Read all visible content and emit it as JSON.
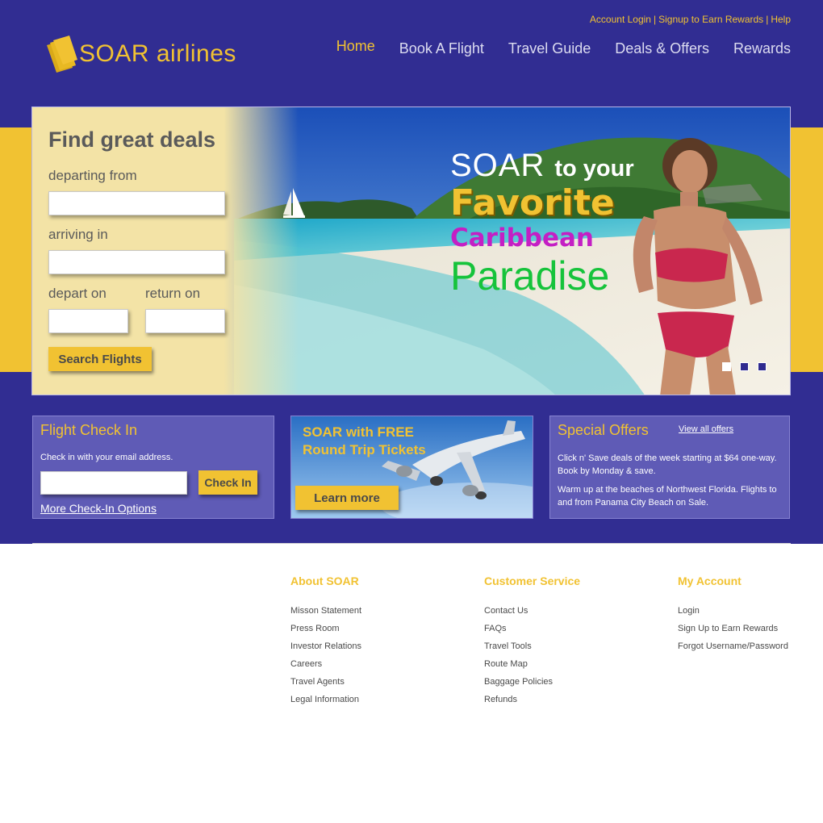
{
  "header": {
    "top_links": [
      "Account Login",
      "Signup to Earn Rewards",
      "Help"
    ],
    "logo": {
      "text": "SOAR airlines",
      "icon": "ticket-stack-icon"
    },
    "nav": [
      {
        "label": "Home",
        "active": true
      },
      {
        "label": "Book A Flight",
        "active": false
      },
      {
        "label": "Travel Guide",
        "active": false
      },
      {
        "label": "Deals & Offers",
        "active": false
      },
      {
        "label": "Rewards",
        "active": false
      }
    ]
  },
  "search": {
    "title": "Find great deals",
    "departing_label": "departing from",
    "departing_value": "",
    "arriving_label": "arriving in",
    "arriving_value": "",
    "depart_label": "depart on",
    "depart_value": "",
    "return_label": "return on",
    "return_value": "",
    "button": "Search Flights"
  },
  "hero_promo": {
    "soar": "SOAR",
    "to_your": "to your",
    "favorite": "Favorite",
    "caribbean": "Caribbean",
    "paradise": "Paradise",
    "slides": 3,
    "active_slide": 1
  },
  "checkin": {
    "title": "Flight Check In",
    "text": "Check in with your email address.",
    "input_value": "",
    "button": "Check In",
    "more": "More Check-In Options"
  },
  "free_tickets": {
    "line1": "SOAR with FREE",
    "line2": "Round Trip Tickets",
    "button": "Learn more"
  },
  "offers": {
    "title": "Special Offers",
    "link": "View all offers",
    "p1": "Click n' Save deals of the week starting at $64 one-way. Book by Monday & save.",
    "p2": "Warm up at the beaches of Northwest Florida. Flights to and from Panama City Beach on Sale."
  },
  "footer": {
    "about": {
      "title": "About SOAR",
      "links": [
        "Misson Statement",
        "Press Room",
        "Investor Relations",
        "Careers",
        "Travel Agents",
        "Legal Information"
      ]
    },
    "service": {
      "title": "Customer Service",
      "links": [
        "Contact Us",
        "FAQs",
        "Travel Tools",
        "Route Map",
        "Baggage Policies",
        "Refunds"
      ]
    },
    "account": {
      "title": "My Account",
      "links": [
        "Login",
        "Sign Up to Earn Rewards",
        "Forgot Username/Password"
      ]
    }
  },
  "colors": {
    "brand_purple": "#312d92",
    "brand_yellow": "#f1c232",
    "panel_purple": "#5f5bb6"
  }
}
